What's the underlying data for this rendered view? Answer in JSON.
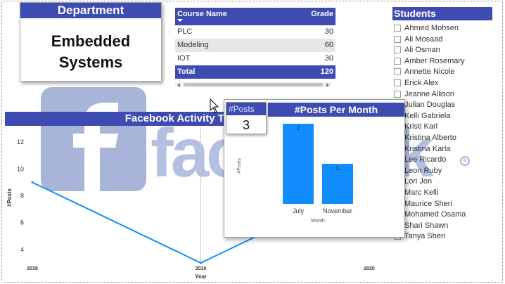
{
  "department": {
    "header": "Department",
    "value_line1": "Embedded",
    "value_line2": "Systems"
  },
  "course_table": {
    "headers": {
      "name": "Course Name",
      "grade": "Grade"
    },
    "rows": [
      {
        "name": "PLC",
        "grade": "30"
      },
      {
        "name": "Modeling",
        "grade": "60"
      },
      {
        "name": "IOT",
        "grade": "30"
      }
    ],
    "total": {
      "name": "Total",
      "grade": "120"
    }
  },
  "watermark": {
    "letter": "f",
    "word": "facebook",
    "registered": "®"
  },
  "students": {
    "header": "Students",
    "items": [
      "Ahmed Mohsen",
      "Ali Mosaad",
      "Ali Osman",
      "Amber Rosemary",
      "Annette Nicole",
      "Erick Alex",
      "Jeanne Allison",
      "Julian Douglas",
      "Kelli Gabriela",
      "Kristi Karl",
      "Kristina Alberto",
      "Kristina Karla",
      "Lee Ricardo",
      "Leon Ruby",
      "Lori Jon",
      "Marc Kelli",
      "Maurice Sheri",
      "Mohamed Osama",
      "Shari Shawn",
      "Tanya Sheri"
    ]
  },
  "activity_chart": {
    "title": "Facebook Activity Timeline",
    "xlabel": "Year",
    "ylabel": "#Posts"
  },
  "popup": {
    "title": "#Posts Per Month",
    "kpi_label": "#Posts",
    "kpi_value": "3"
  },
  "colors": {
    "accent": "#3e4bb0",
    "series": "#118dff",
    "watermark": "#9aa8d2"
  },
  "chart_data": [
    {
      "type": "line",
      "title": "Facebook Activity Timeline",
      "xlabel": "Year",
      "ylabel": "#Posts",
      "x": [
        2018,
        2019,
        2020
      ],
      "x_ticks": [
        "2018",
        "2019",
        "2020"
      ],
      "values": [
        9,
        3,
        9
      ],
      "y_ticks": [
        "4",
        "6",
        "8",
        "10",
        "12"
      ],
      "ylim": [
        3,
        13
      ],
      "grid": false
    },
    {
      "type": "bar",
      "title": "#Posts Per Month",
      "xlabel": "Month",
      "ylabel": "#Posts",
      "categories": [
        "July",
        "November"
      ],
      "values": [
        2,
        1
      ],
      "data_labels": [
        "2",
        "1"
      ],
      "ylim": [
        0,
        2
      ],
      "grid": false
    }
  ]
}
